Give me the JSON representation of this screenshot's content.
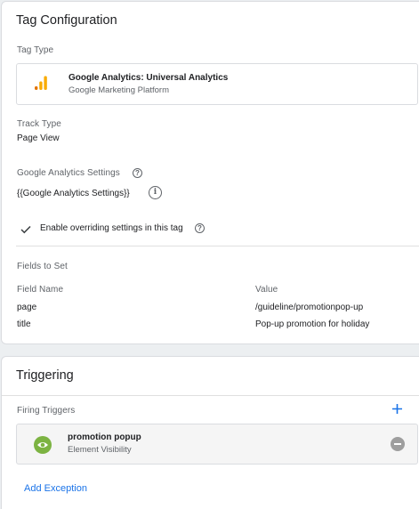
{
  "tag_configuration": {
    "title": "Tag Configuration",
    "tag_type_label": "Tag Type",
    "tag_type": {
      "name": "Google Analytics: Universal Analytics",
      "vendor": "Google Marketing Platform",
      "icon": "analytics-bars-icon",
      "icon_color": "#f9ab00"
    },
    "track_type_label": "Track Type",
    "track_type_value": "Page View",
    "ga_settings_label": "Google Analytics Settings",
    "ga_settings_value": "{{Google Analytics Settings}}",
    "override_checkbox": {
      "label": "Enable overriding settings in this tag",
      "checked": true
    },
    "fields_to_set": {
      "label": "Fields to Set",
      "columns": [
        "Field Name",
        "Value"
      ],
      "rows": [
        {
          "field": "page",
          "value": "/guideline/promotionpop-up"
        },
        {
          "field": "title",
          "value": "Pop-up promotion for holiday"
        }
      ]
    }
  },
  "triggering": {
    "title": "Triggering",
    "firing_triggers_label": "Firing Triggers",
    "trigger": {
      "name": "promotion popup",
      "type": "Element Visibility",
      "icon": "eye-icon",
      "icon_color": "#7cb342"
    },
    "add_exception_label": "Add Exception",
    "accent_color": "#1a73e8"
  }
}
